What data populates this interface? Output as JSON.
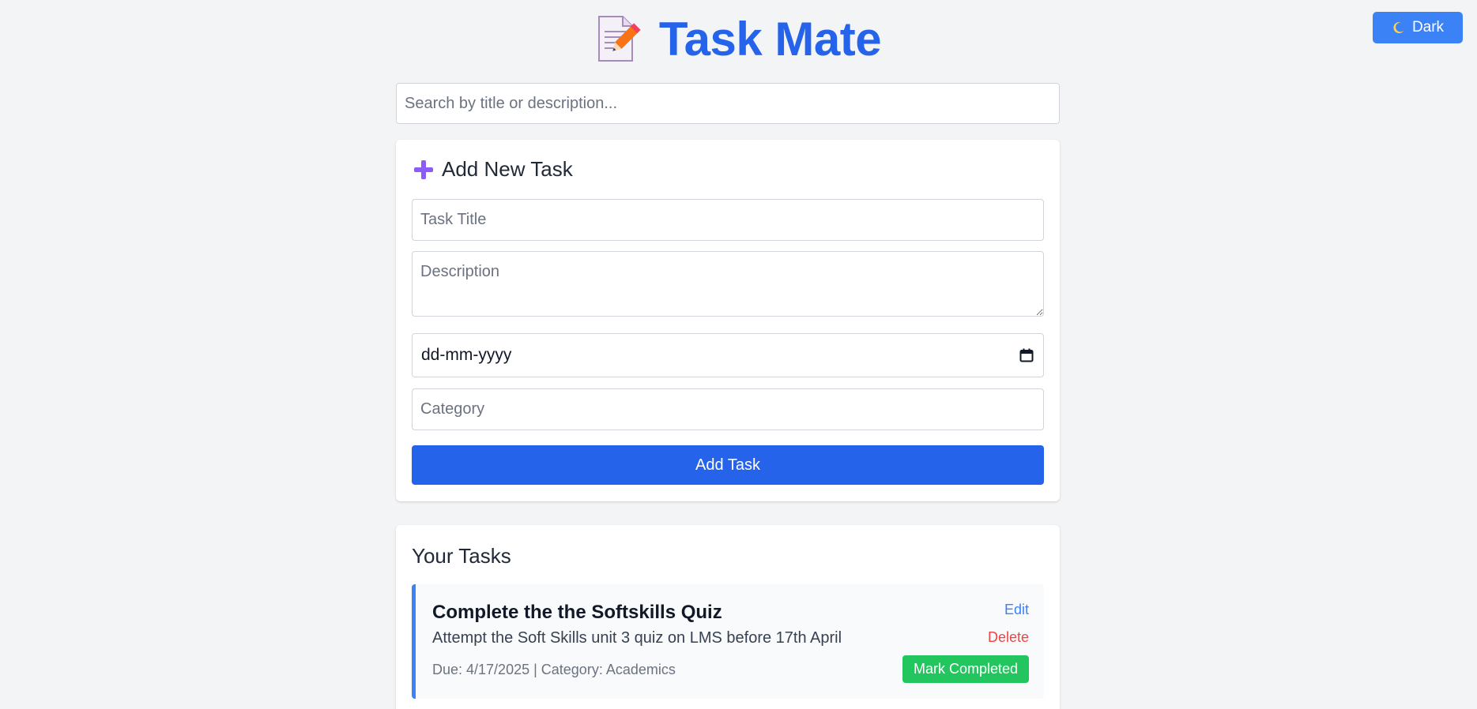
{
  "app": {
    "title": "Task Mate",
    "logo_icon": "memo-icon"
  },
  "theme_toggle": {
    "icon": "moon-icon",
    "label": "Dark"
  },
  "search": {
    "placeholder": "Search by title or description...",
    "value": ""
  },
  "add_form": {
    "heading_icon": "plus-icon",
    "heading": "Add New Task",
    "title_placeholder": "Task Title",
    "description_placeholder": "Description",
    "date_placeholder": "dd-mm-yyyy",
    "date_icon": "calendar-icon",
    "category_placeholder": "Category",
    "submit_label": "Add Task"
  },
  "tasks": {
    "heading": "Your Tasks",
    "items": [
      {
        "title": "Complete the the Softskills Quiz",
        "description": "Attempt the Soft Skills unit 3 quiz on LMS before 17th April",
        "meta": "Due: 4/17/2025 | Category: Academics",
        "edit_label": "Edit",
        "delete_label": "Delete",
        "complete_label": "Mark Completed"
      }
    ]
  },
  "colors": {
    "primary": "#2563eb",
    "toggle": "#3b82f6",
    "danger": "#ef4444",
    "success": "#22c55e",
    "background": "#f3f4f6"
  }
}
